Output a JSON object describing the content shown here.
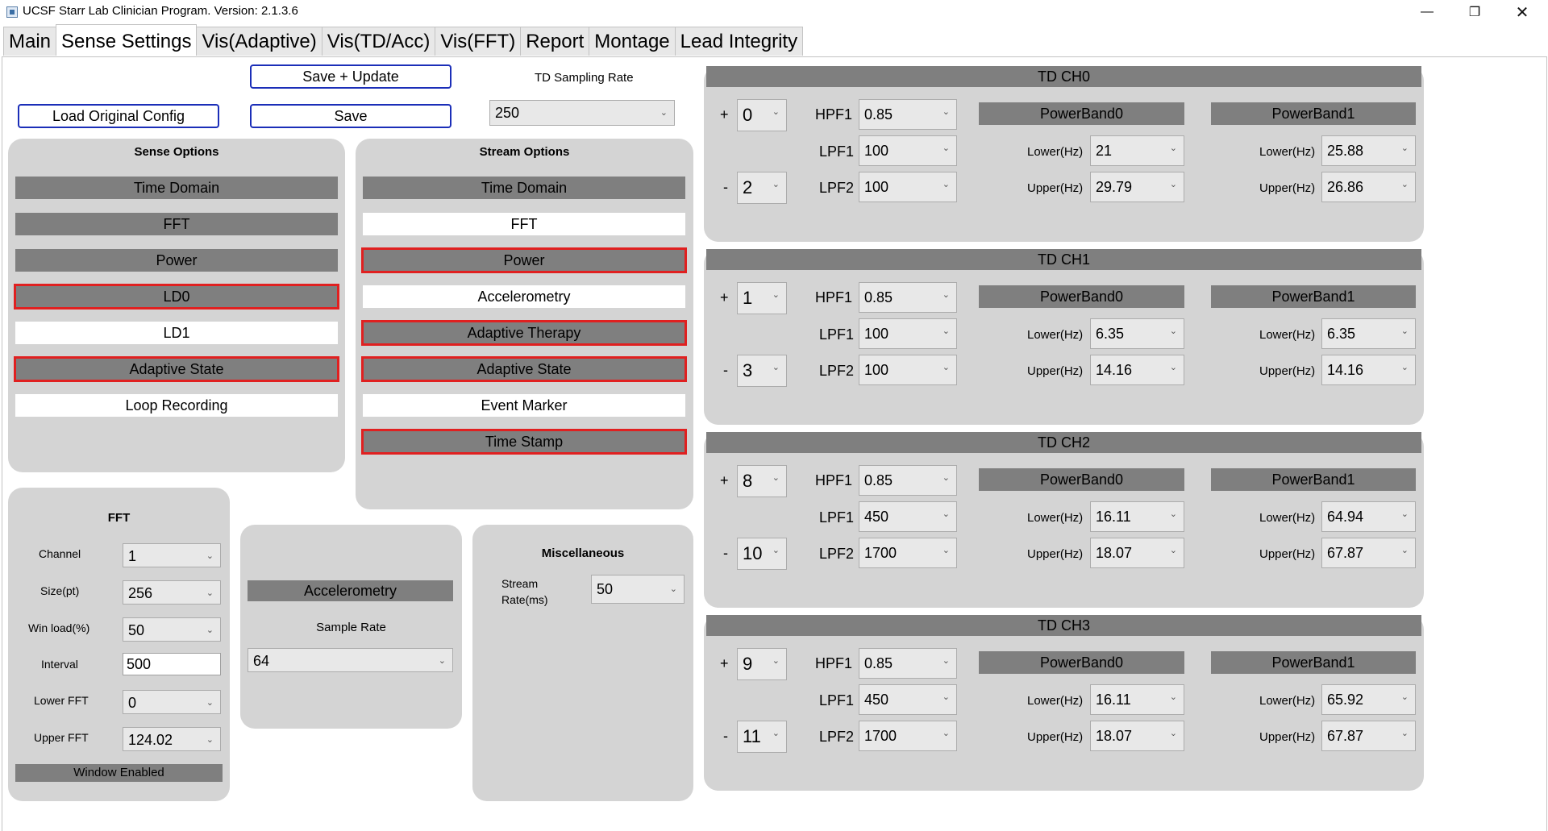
{
  "window": {
    "title": "UCSF Starr Lab Clinician Program. Version: 2.1.3.6"
  },
  "tabs": [
    "Main",
    "Sense Settings",
    "Vis(Adaptive)",
    "Vis(TD/Acc)",
    "Vis(FFT)",
    "Report",
    "Montage",
    "Lead Integrity"
  ],
  "buttons": {
    "save_update": "Save + Update",
    "load_original": "Load Original Config",
    "save": "Save"
  },
  "td_sampling": {
    "label": "TD Sampling Rate",
    "value": "250"
  },
  "sense_options": {
    "title": "Sense Options",
    "items": [
      {
        "label": "Time Domain",
        "state": "gray"
      },
      {
        "label": "FFT",
        "state": "gray"
      },
      {
        "label": "Power",
        "state": "gray"
      },
      {
        "label": "LD0",
        "state": "gray-red"
      },
      {
        "label": "LD1",
        "state": "white"
      },
      {
        "label": "Adaptive State",
        "state": "gray-red"
      },
      {
        "label": "Loop Recording",
        "state": "white"
      }
    ]
  },
  "stream_options": {
    "title": "Stream Options",
    "items": [
      {
        "label": "Time Domain",
        "state": "gray"
      },
      {
        "label": "FFT",
        "state": "white"
      },
      {
        "label": "Power",
        "state": "gray-red"
      },
      {
        "label": "Accelerometry",
        "state": "white"
      },
      {
        "label": "Adaptive Therapy",
        "state": "gray-red"
      },
      {
        "label": "Adaptive State",
        "state": "gray-red"
      },
      {
        "label": "Event Marker",
        "state": "white"
      },
      {
        "label": "Time Stamp",
        "state": "gray-red"
      }
    ]
  },
  "fft": {
    "title": "FFT",
    "channel_label": "Channel",
    "channel": "1",
    "size_label": "Size(pt)",
    "size": "256",
    "winload_label": "Win load(%)",
    "winload": "50",
    "interval_label": "Interval",
    "interval": "500",
    "lower_label": "Lower FFT",
    "lower": "0",
    "upper_label": "Upper FFT",
    "upper": "124.02",
    "window_enabled": "Window Enabled"
  },
  "accel": {
    "header": "Accelerometry",
    "sample_rate_label": "Sample Rate",
    "sample_rate": "64"
  },
  "misc": {
    "title": "Miscellaneous",
    "stream_rate_label": "Stream\nRate(ms)",
    "stream_rate": "50"
  },
  "td_labels": {
    "plus": "+",
    "minus": "-",
    "hpf1": "HPF1",
    "lpf1": "LPF1",
    "lpf2": "LPF2",
    "pb0": "PowerBand0",
    "pb1": "PowerBand1",
    "lower": "Lower(Hz)",
    "upper": "Upper(Hz)"
  },
  "td_channels": [
    {
      "title": "TD CH0",
      "plus": "0",
      "minus": "2",
      "hpf1": "0.85",
      "lpf1": "100",
      "lpf2": "100",
      "pb0_lower": "21",
      "pb0_upper": "29.79",
      "pb1_lower": "25.88",
      "pb1_upper": "26.86"
    },
    {
      "title": "TD CH1",
      "plus": "1",
      "minus": "3",
      "hpf1": "0.85",
      "lpf1": "100",
      "lpf2": "100",
      "pb0_lower": "6.35",
      "pb0_upper": "14.16",
      "pb1_lower": "6.35",
      "pb1_upper": "14.16"
    },
    {
      "title": "TD CH2",
      "plus": "8",
      "minus": "10",
      "hpf1": "0.85",
      "lpf1": "450",
      "lpf2": "1700",
      "pb0_lower": "16.11",
      "pb0_upper": "18.07",
      "pb1_lower": "64.94",
      "pb1_upper": "67.87"
    },
    {
      "title": "TD CH3",
      "plus": "9",
      "minus": "11",
      "hpf1": "0.85",
      "lpf1": "450",
      "lpf2": "1700",
      "pb0_lower": "16.11",
      "pb0_upper": "18.07",
      "pb1_lower": "65.92",
      "pb1_upper": "67.87"
    }
  ]
}
